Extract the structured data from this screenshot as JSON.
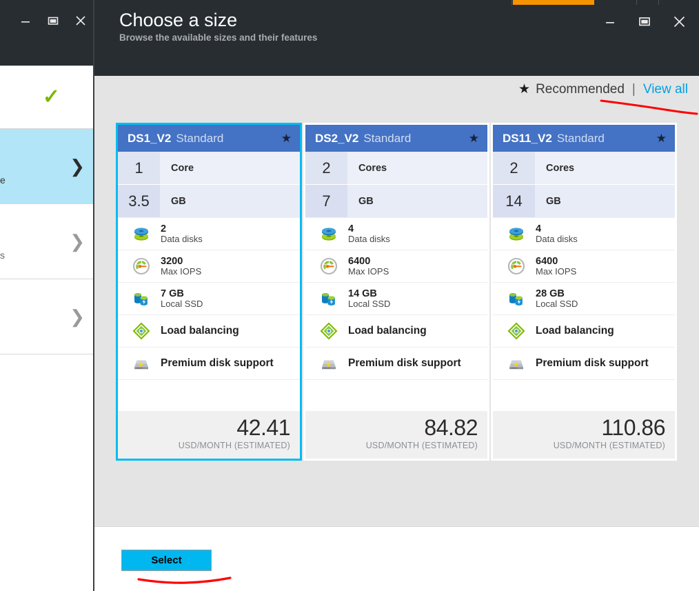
{
  "window": {
    "background_blade": {
      "minimize_icon": "minimize-icon",
      "restore_icon": "restore-icon",
      "close_icon": "close-icon",
      "check_icon": "check-icon",
      "rows": [
        {
          "fragment": "e",
          "chevron": "chevron-right-icon",
          "selected": true
        },
        {
          "fragment": "s",
          "chevron": "chevron-right-icon",
          "selected": false
        },
        {
          "fragment": "",
          "chevron": "chevron-right-icon",
          "selected": false
        }
      ]
    },
    "controls": {
      "minimize_icon": "minimize-icon",
      "restore_icon": "restore-icon",
      "close_icon": "close-icon"
    }
  },
  "header": {
    "title": "Choose a size",
    "subtitle": "Browse the available sizes and their features"
  },
  "toolbar": {
    "star_icon": "star-icon",
    "recommended_label": "Recommended",
    "separator": "|",
    "view_all_label": "View all"
  },
  "colors": {
    "accent_cyan": "#00bcf2",
    "card_header_blue": "#4472c4",
    "button_blue": "#00b7ef",
    "link_blue": "#00a0e4",
    "annotation_red": "#ff0000",
    "chrome_dark": "#282d31",
    "body_gray": "#e4e4e4",
    "top_strip_orange": "#f59300"
  },
  "cards": [
    {
      "name": "DS1_V2",
      "tier": "Standard",
      "star_icon": "star-icon",
      "selected": true,
      "cores": {
        "value": "1",
        "label": "Core"
      },
      "memory": {
        "value": "3.5",
        "label": "GB"
      },
      "features": [
        {
          "icon": "data-disks-icon",
          "value": "2",
          "label": "Data disks"
        },
        {
          "icon": "max-iops-gauge-icon",
          "value": "3200",
          "label": "Max IOPS"
        },
        {
          "icon": "local-ssd-icon",
          "value": "7 GB",
          "label": "Local SSD"
        },
        {
          "icon": "load-balancing-icon",
          "value": "",
          "label": "Load balancing"
        },
        {
          "icon": "premium-disk-icon",
          "value": "",
          "label": "Premium disk support"
        }
      ],
      "price": "42.41",
      "price_unit": "USD/MONTH (ESTIMATED)"
    },
    {
      "name": "DS2_V2",
      "tier": "Standard",
      "star_icon": "star-icon",
      "selected": false,
      "cores": {
        "value": "2",
        "label": "Cores"
      },
      "memory": {
        "value": "7",
        "label": "GB"
      },
      "features": [
        {
          "icon": "data-disks-icon",
          "value": "4",
          "label": "Data disks"
        },
        {
          "icon": "max-iops-gauge-icon",
          "value": "6400",
          "label": "Max IOPS"
        },
        {
          "icon": "local-ssd-icon",
          "value": "14 GB",
          "label": "Local SSD"
        },
        {
          "icon": "load-balancing-icon",
          "value": "",
          "label": "Load balancing"
        },
        {
          "icon": "premium-disk-icon",
          "value": "",
          "label": "Premium disk support"
        }
      ],
      "price": "84.82",
      "price_unit": "USD/MONTH (ESTIMATED)"
    },
    {
      "name": "DS11_V2",
      "tier": "Standard",
      "star_icon": "star-icon",
      "selected": false,
      "cores": {
        "value": "2",
        "label": "Cores"
      },
      "memory": {
        "value": "14",
        "label": "GB"
      },
      "features": [
        {
          "icon": "data-disks-icon",
          "value": "4",
          "label": "Data disks"
        },
        {
          "icon": "max-iops-gauge-icon",
          "value": "6400",
          "label": "Max IOPS"
        },
        {
          "icon": "local-ssd-icon",
          "value": "28 GB",
          "label": "Local SSD"
        },
        {
          "icon": "load-balancing-icon",
          "value": "",
          "label": "Load balancing"
        },
        {
          "icon": "premium-disk-icon",
          "value": "",
          "label": "Premium disk support"
        }
      ],
      "price": "110.86",
      "price_unit": "USD/MONTH (ESTIMATED)"
    }
  ],
  "footer": {
    "select_label": "Select"
  }
}
